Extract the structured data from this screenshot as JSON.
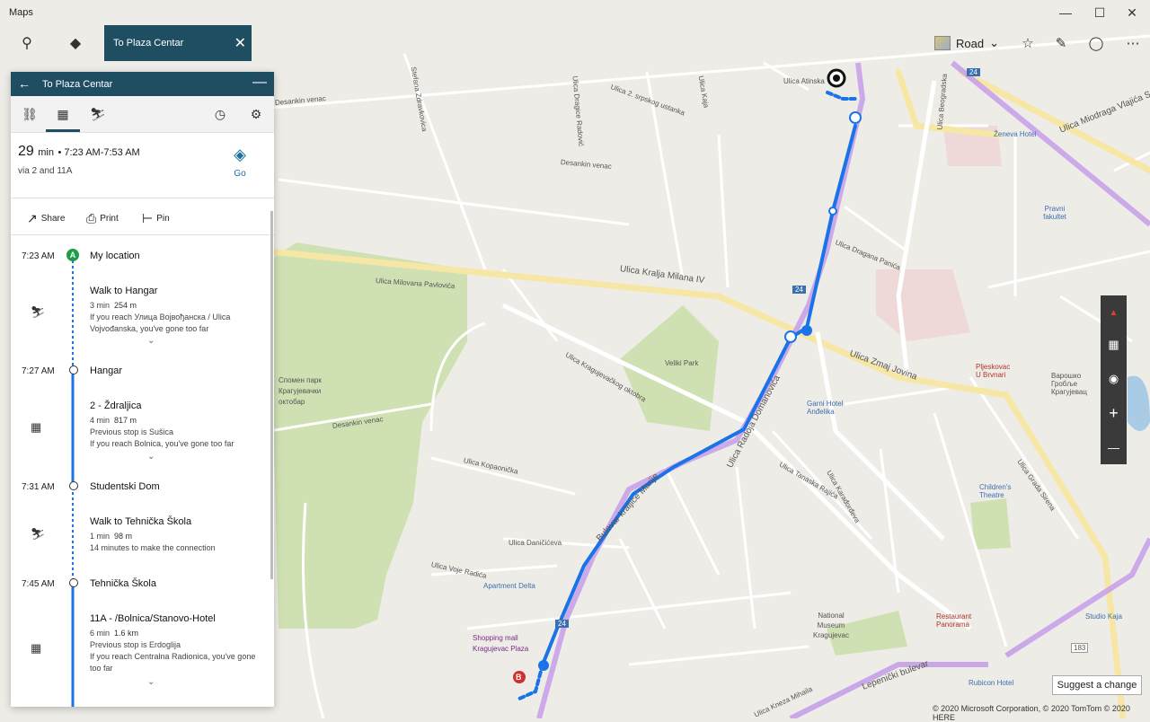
{
  "window": {
    "title": "Maps",
    "minimize": "—",
    "maximize": "☐",
    "close": "✕"
  },
  "toolbar": {
    "search_icon": "search-icon",
    "directions_icon": "directions-icon",
    "route_tab_label": "To Plaza Centar",
    "route_tab_close": "✕",
    "style_label": "Road",
    "style_chevron": "⌄"
  },
  "panel": {
    "title": "To Plaza Centar",
    "summary": {
      "minutes": "29",
      "min_unit": "min",
      "times": "• 7:23 AM-7:53 AM",
      "via": "via 2 and 11A"
    },
    "go_label": "Go",
    "actions": {
      "share": "Share",
      "print": "Print",
      "pin": "Pin"
    },
    "steps": [
      {
        "time": "7:23 AM",
        "title": "My location"
      },
      {
        "title": "Walk to Hangar",
        "duration": "3 min",
        "distance": "254 m",
        "note": "If you reach Улица Војвођанска / Ulica Vojvođanska, you've gone too far"
      },
      {
        "time": "7:27 AM",
        "title": "Hangar"
      },
      {
        "title": "2 - Ždraljica",
        "duration": "4 min",
        "distance": "817 m",
        "prev": "Previous stop is Sušica",
        "note": "If you reach Bolnica, you've gone too far"
      },
      {
        "time": "7:31 AM",
        "title": "Studentski Dom"
      },
      {
        "title": "Walk to Tehnička Škola",
        "duration": "1 min",
        "distance": "98 m",
        "note": "14 minutes to make the connection"
      },
      {
        "time": "7:45 AM",
        "title": "Tehnička Škola"
      },
      {
        "title": "11A - /Bolnica/Stanovo-Hotel",
        "duration": "6 min",
        "distance": "1.6 km",
        "prev": "Previous stop is Erdoglija",
        "note": "If you reach Centralna Radionica, you've gone too far"
      }
    ],
    "pin_a": "A"
  },
  "map": {
    "labels": {
      "zdravkovica": "Stefana Zdravkovica",
      "desankin1": "Desankin venac",
      "desankin2": "Desankin venac",
      "desankin3": "Desankin venac",
      "radojice": "Ulica Dragice Radović",
      "atinska": "Ulica Atinska",
      "ustanka": "Ulica 2. srpskog ustanka",
      "kaja": "Ulica Kaja",
      "beogradska": "Ulica Beogradska",
      "vlajica": "Ulica Miodraga Vlajića Suče",
      "zeneva": "Ženeva Hotel",
      "pravni": "Pravni fakultet",
      "kralja_milana": "Ulica Kralja Milana IV",
      "milovana": "Ulica Milovana Pavlovića",
      "dragana": "Ulica Dragana Panića",
      "zmaj": "Ulica Zmaj Jovina",
      "kragujevackog": "Ulica Kragujevačkog oktobra",
      "veliki_park": "Veliki Park",
      "spomen": "Спомен парк Крагујевачки октобар",
      "radoja": "Ulica Radoja Domanovića",
      "garni": "Garni Hotel Anđelika",
      "pljeskovac": "Pljeskovac U Brvnari",
      "varosko": "Варошко Гробље Крагујевац",
      "kopaonicka": "Ulica Kopaonička",
      "bulevar": "Bulevar kraljice Marije",
      "tanaska": "Ulica Tanaska Rajića",
      "karadjordjeva": "Ulica Karađorđeva",
      "childrens": "Children's Theatre",
      "danicic": "Ulica Daničićeva",
      "voje": "Ulica Voje Radića",
      "apartment": "Apartment Delta",
      "shopping": "Shopping mall Kragujevac Plaza",
      "national": "National Museum Kragujevac",
      "restaurant": "Restaurant Panorama",
      "studio": "Studio Kaja",
      "lepenicki": "Lepenički bulevar",
      "rubicon": "Rubicon Hotel",
      "kneza": "Ulica Kneza Mihaila",
      "grada": "Ulica Grada Sirena",
      "route24a": "24",
      "route24b": "24",
      "route24c": "24",
      "route183": "183"
    },
    "pin_b": "B"
  },
  "controls": {
    "compass": "▲",
    "grid": "▦",
    "locate": "◉",
    "zoom_in": "+",
    "zoom_out": "—"
  },
  "suggest": "Suggest a change",
  "copyright": "© 2020 Microsoft Corporation, © 2020 TomTom © 2020 HERE",
  "colors": {
    "accent": "#1f4e63",
    "route": "#1a73e8",
    "transit_line": "#c9a5e8",
    "park": "#c9dfa8",
    "major_road": "#f4e49a"
  }
}
